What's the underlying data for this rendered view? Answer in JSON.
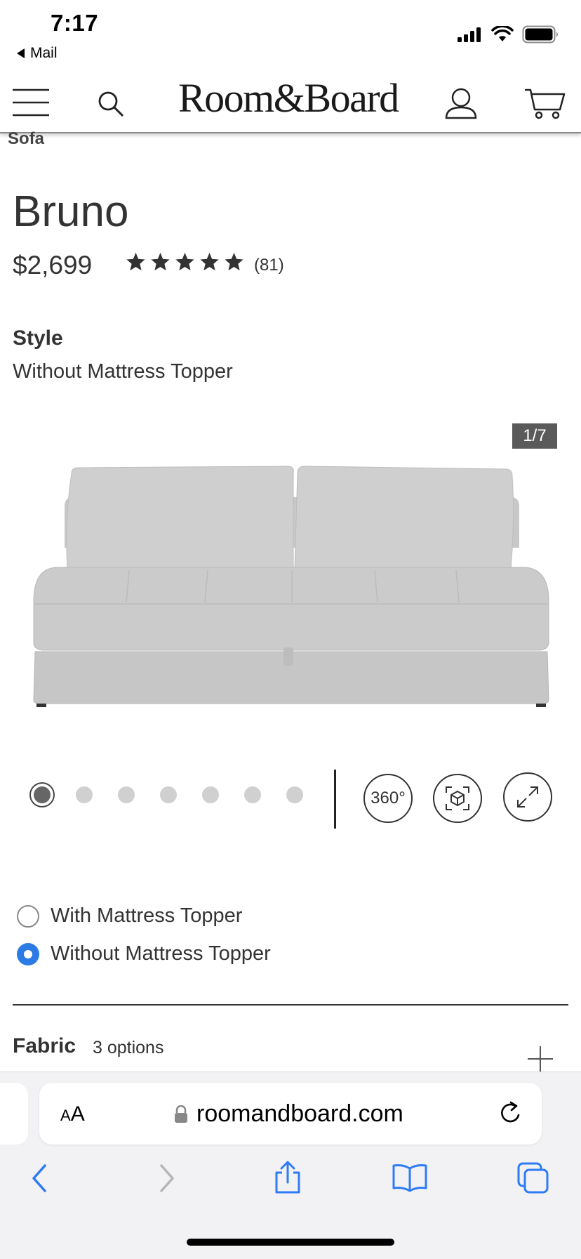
{
  "status_bar": {
    "time": "7:17",
    "back_label": "Mail"
  },
  "header": {
    "logo": "Room&Board"
  },
  "breadcrumb": "Sofa",
  "product": {
    "title": "Bruno",
    "price": "$2,699",
    "rating": 5,
    "review_count": "(81)",
    "style_label": "Style",
    "style_value": "Without Mattress Topper",
    "image_counter": "1/7",
    "image_count": 7,
    "active_image": 1
  },
  "media_buttons": {
    "spin": "360°"
  },
  "style_options": [
    {
      "label": "With Mattress Topper",
      "selected": false
    },
    {
      "label": "Without Mattress Topper",
      "selected": true
    }
  ],
  "fabric": {
    "label": "Fabric",
    "options": "3 options"
  },
  "browser": {
    "text_size": {
      "small": "A",
      "large": "A"
    },
    "url": "roomandboard.com"
  },
  "colors": {
    "accent": "#2c7be5",
    "safari_blue": "#2f7bf6",
    "text": "#333333"
  }
}
